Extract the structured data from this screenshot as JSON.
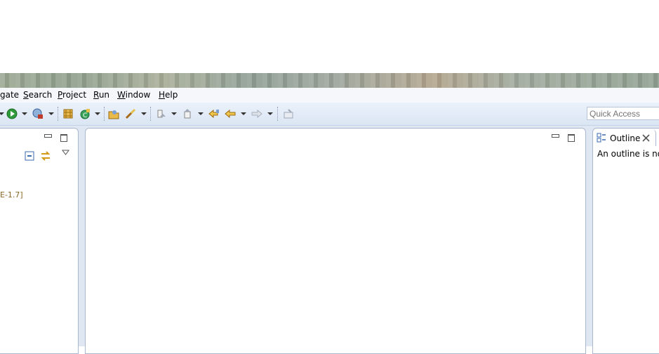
{
  "menu": {
    "items": [
      {
        "pre": "",
        "mn": "",
        "post": "gate"
      },
      {
        "pre": "",
        "mn": "S",
        "post": "earch"
      },
      {
        "pre": "",
        "mn": "P",
        "post": "roject"
      },
      {
        "pre": "",
        "mn": "R",
        "post": "un"
      },
      {
        "pre": "",
        "mn": "W",
        "post": "indow"
      },
      {
        "pre": "",
        "mn": "H",
        "post": "elp"
      }
    ]
  },
  "quick_access": {
    "placeholder": "Quick Access"
  },
  "left_panel": {
    "tree_item": "E-1.7]"
  },
  "outline": {
    "tab_label": "Outline",
    "message": "An outline is not"
  },
  "icons": [
    "run-icon",
    "debug-icon",
    "coverage-icon",
    "new-java-package-icon",
    "new-class-icon",
    "open-type-icon",
    "search-icon",
    "next-annotation-icon",
    "prev-annotation-icon",
    "last-edit-location-icon",
    "back-icon",
    "forward-icon",
    "pin-editor-icon"
  ]
}
